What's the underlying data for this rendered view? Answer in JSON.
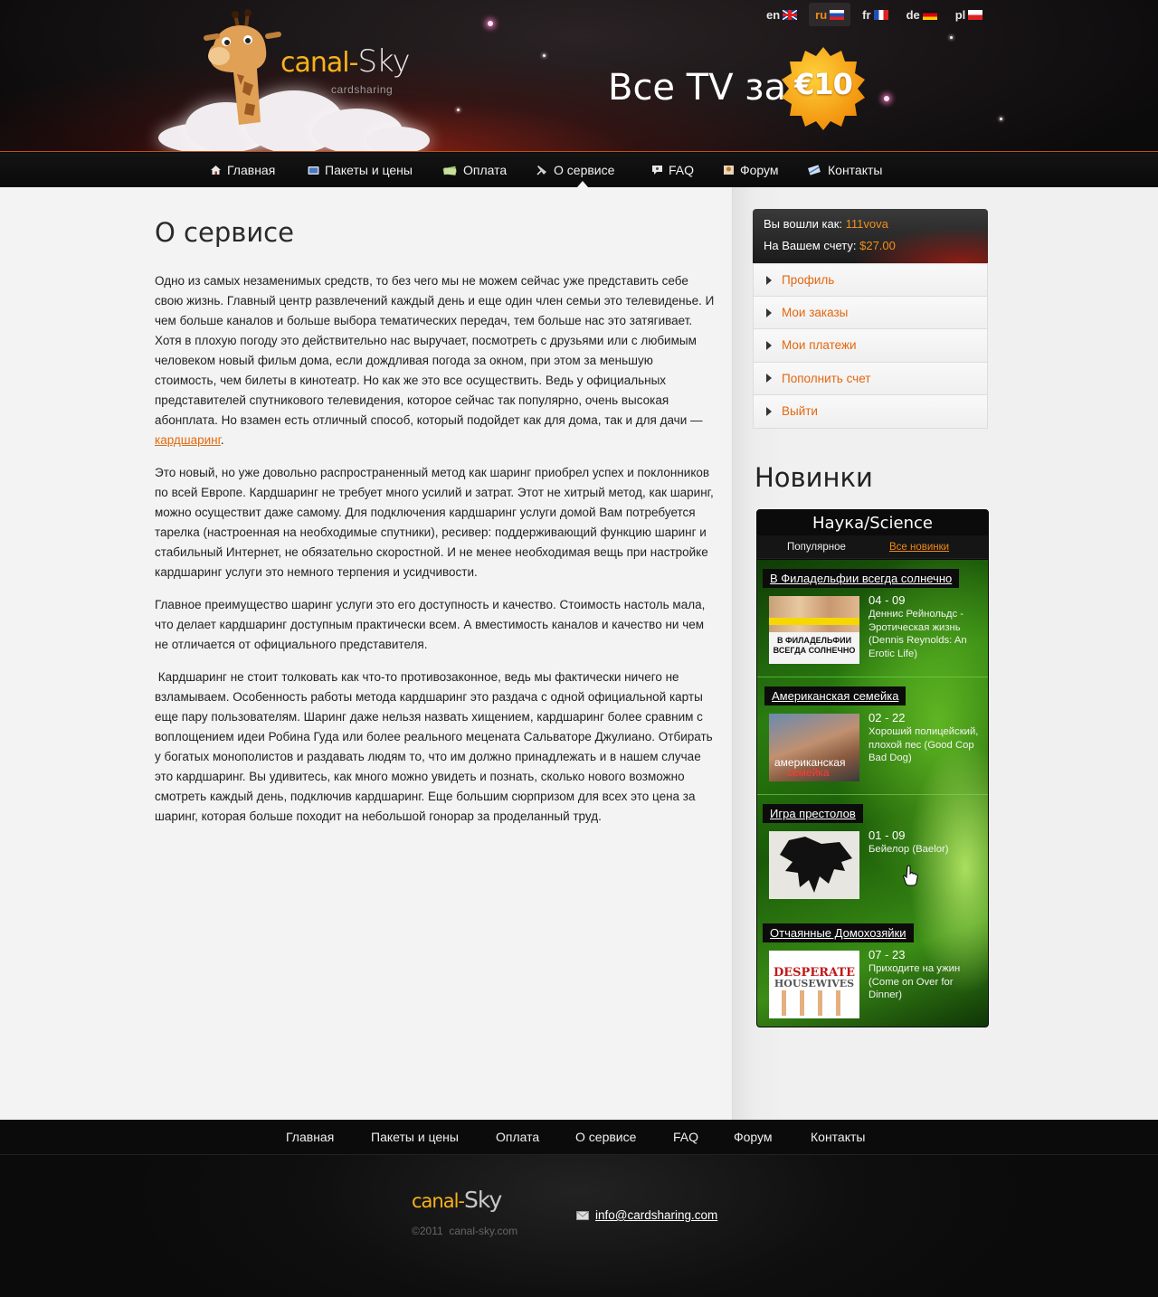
{
  "languages": [
    {
      "code": "en",
      "active": false
    },
    {
      "code": "ru",
      "active": true
    },
    {
      "code": "fr",
      "active": false
    },
    {
      "code": "de",
      "active": false
    },
    {
      "code": "pl",
      "active": false
    }
  ],
  "brand": {
    "name_part1": "canal-",
    "name_part2": "Sky",
    "subtitle": "cardsharing"
  },
  "promo": {
    "text": "Все TV за",
    "price": "€10"
  },
  "nav": [
    {
      "label": "Главная",
      "icon": "home-icon"
    },
    {
      "label": "Пакеты и цены",
      "icon": "tv-icon"
    },
    {
      "label": "Оплата",
      "icon": "money-icon"
    },
    {
      "label": "О сервисе",
      "icon": "satellite-icon",
      "active": true
    },
    {
      "label": "FAQ",
      "icon": "faq-icon"
    },
    {
      "label": "Форум",
      "icon": "forum-icon"
    },
    {
      "label": "Контакты",
      "icon": "contacts-icon"
    }
  ],
  "page": {
    "title": "О сервисе",
    "paragraphs": [
      {
        "text": "Одно из самых незаменимых средств, то без чего мы не можем сейчас уже представить себе свою жизнь. Главный центр развлечений каждый день и еще один член семьи это телевиденье. И чем больше каналов и больше выбора тематических передач, тем больше нас это затягивает. Хотя в плохую погоду это действительно нас выручает, посмотреть с друзьями или с любимым человеком новый фильм дома, если дождливая погода за окном, при этом за меньшую стоимость, чем билеты в кинотеатр. Но как же это все осуществить. Ведь у официальных представителей спутникового телевидения, которое сейчас так популярно, очень высокая абонплата. Но взамен есть отличный способ, который подойдет как для дома, так и для дачи — ",
        "link": "кардшаринг",
        "after": "."
      },
      {
        "text": "Это новый, но уже довольно распространенный метод как шаринг приобрел успех и поклонников по всей Европе. Кардшаринг не требует много усилий и затрат. Этот не хитрый метод, как шаринг, можно осуществит даже самому. Для подключения кардшаринг услуги домой Вам потребуется тарелка (настроенная на необходимые спутники), ресивер: поддерживающий функцию шаринг и стабильный Интернет, не обязательно скоростной. И не менее необходимая вещь при настройке кардшаринг услуги это немного терпения и усидчивости."
      },
      {
        "text": "Главное преимущество шаринг услуги это его доступность и качество. Стоимость настоль мала, что делает кардшаринг доступным практически всем. А вместимость каналов и качество ни чем не отличается от официального представителя."
      },
      {
        "text": " Кардшаринг не стоит толковать как что-то противозаконное, ведь мы фактически ничего не взламываем. Особенность работы метода кардшаринг это раздача с одной официальной карты еще пару пользователям. Шаринг даже нельзя назвать хищением, кардшаринг более сравним с воплощением идеи Робина Гуда или более реального мецената Сальваторе Джулиано. Отбирать у богатых монополистов и раздавать людям то, что им должно принадлежать и в нашем случае это кардшаринг. Вы удивитесь, как много можно увидеть и познать, сколько нового возможно смотреть каждый день, подключив кардшаринг. Еще большим сюрпризом для всех это цена за шаринг, которая больше походит на небольшой гонорар за проделанный труд."
      }
    ]
  },
  "account": {
    "logged_in_label": "Вы вошли как:",
    "username": "111vova",
    "balance_label": "На Вашем счету:",
    "balance": "$27.00",
    "menu": [
      "Профиль",
      "Мои заказы",
      "Мои платежи",
      "Пополнить счет",
      "Выйти"
    ]
  },
  "new_releases": {
    "title": "Новинки",
    "category": "Наука/Science",
    "tabs": [
      {
        "label": "Популярное",
        "active": false
      },
      {
        "label": "Все новинки",
        "active": true
      }
    ],
    "shows": [
      {
        "title": "В Филадельфии всегда солнечно",
        "episode": "04 - 09",
        "description": "Деннис Рейнольдс - Эротическая жизнь (Dennis Reynolds: An Erotic Life)",
        "poster_text": "В ФИЛАДЕЛЬФИИ ВСЕГДА СОЛНЕЧНО"
      },
      {
        "title": "Американская семейка",
        "episode": "02 - 22",
        "description": "Хороший полицейский, плохой пес (Good Cop Bad Dog)",
        "poster_text1": "американская",
        "poster_text2": "семейка"
      },
      {
        "title": "Игра престолов",
        "episode": "01 - 09",
        "description": "Бейелор (Baelor)"
      },
      {
        "title": "Отчаянные Домохозяйки",
        "episode": "07 - 23",
        "description": "Приходите на ужин (Come on Over for Dinner)",
        "poster_text1": "DESPERATE",
        "poster_text2": "HOUSEWIVES"
      }
    ]
  },
  "footer": {
    "nav": [
      "Главная",
      "Пакеты и цены",
      "Оплата",
      "О сервисе",
      "FAQ",
      "Форум",
      "Контакты"
    ],
    "copyright": "©2011  canal-sky.com",
    "email": "info@cardsharing.com"
  },
  "colors": {
    "accent": "#e5660f",
    "logo_yellow": "#f6b21b",
    "widget_green": "#2b7d10"
  }
}
